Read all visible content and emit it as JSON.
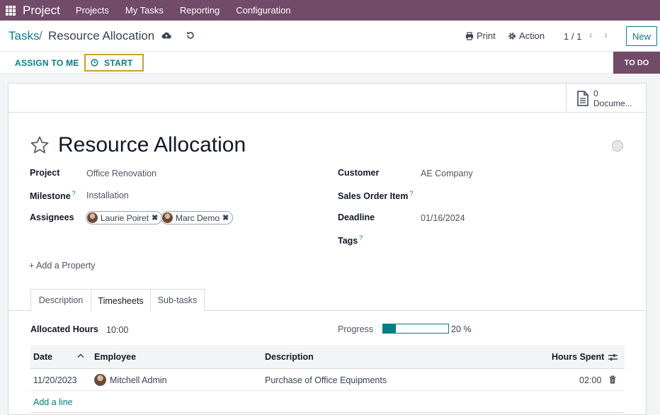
{
  "navbar": {
    "brand": "Project",
    "menu": [
      "Projects",
      "My Tasks",
      "Reporting",
      "Configuration"
    ]
  },
  "breadcrumb": {
    "parent": "Tasks",
    "separator": "/",
    "current": "Resource Allocation"
  },
  "toolbar": {
    "print_label": "Print",
    "action_label": "Action",
    "pager": "1 / 1",
    "prev": "‹",
    "next": "›",
    "new_label": "New"
  },
  "statusbar": {
    "assign_label": "ASSIGN TO ME",
    "start_label": "START",
    "stage_label": "TO DO"
  },
  "smart_button": {
    "count": "0",
    "label": "Docume..."
  },
  "task": {
    "title": "Resource Allocation"
  },
  "fields": {
    "project_label": "Project",
    "project_value": "Office Renovation",
    "milestone_label": "Milestone",
    "milestone_value": "Installation",
    "assignees_label": "Assignees",
    "assignees": [
      "Laurie Poiret",
      "Marc Demo"
    ],
    "customer_label": "Customer",
    "customer_value": "AE Company",
    "sales_order_label": "Sales Order Item",
    "deadline_label": "Deadline",
    "deadline_value": "01/16/2024",
    "tags_label": "Tags",
    "help_mark": "?",
    "remove_mark": "✖"
  },
  "add_property_label": "+ Add a Property",
  "tabs": [
    "Description",
    "Timesheets",
    "Sub-tasks"
  ],
  "active_tab": "Timesheets",
  "timesheets": {
    "allocated_label": "Allocated Hours",
    "allocated_value": "10:00",
    "progress_label": "Progress",
    "progress_value": 0.2,
    "progress_text": "20 %",
    "columns": [
      "Date",
      "Employee",
      "Description",
      "Hours Spent"
    ],
    "rows": [
      {
        "date": "11/20/2023",
        "employee": "Mitchell Admin",
        "description": "Purchase of Office Equipments",
        "hours": "02:00"
      }
    ],
    "add_line_label": "Add a line"
  },
  "colors": {
    "brand": "#714b67",
    "accent": "#017e84",
    "highlight": "#c8a12a"
  }
}
